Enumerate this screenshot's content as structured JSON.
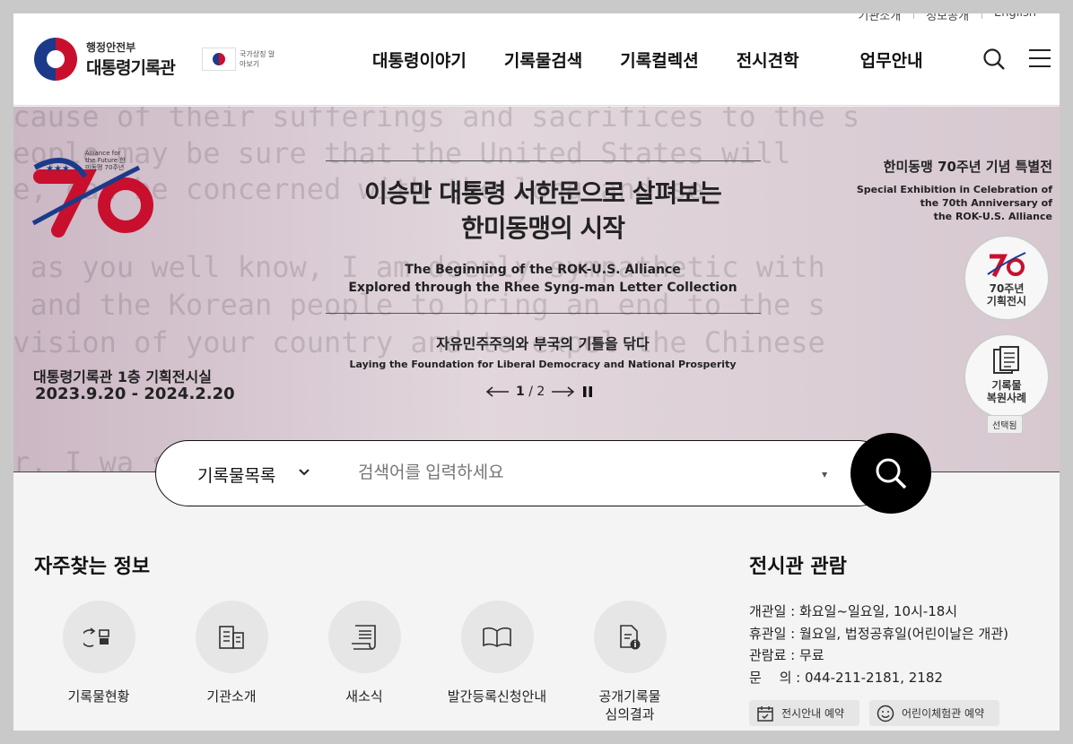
{
  "topbar": [
    "기관소개",
    "정보공개",
    "English"
  ],
  "logo": {
    "small": "행정안전부",
    "big": "대통령기록관"
  },
  "flag_text": "국가상징 알아보기",
  "gnb": [
    "대통령이야기",
    "기록물검색",
    "기록컬렉션",
    "전시견학",
    "업무안내"
  ],
  "banner": {
    "badge_small": "Alliance for the Future 한미동맹 70주년",
    "venue": "대통령기록관 1층 기획전시실",
    "dates": "2023.9.20 - 2024.2.20",
    "title_line1": "이승만 대통령 서한문으로 살펴보는",
    "title_line2": "한미동맹의 시작",
    "subtitle_en_line1": "The Beginning of the ROK-U.S. Alliance",
    "subtitle_en_line2": "Explored through the Rhee Syng-man Letter Collection",
    "sub_ko": "자유민주주의와 부국의 기틀을 닦다",
    "sub_en": "Laying the Foundation for Liberal Democracy and National Prosperity",
    "right_title_ko": "한미동맹 70주년 기념 특별전",
    "right_title_en1": "Special Exhibition in Celebration of",
    "right_title_en2": "the 70th Anniversary of",
    "right_title_en3": "the ROK-U.S. Alliance",
    "circle1_line1": "70주년",
    "circle1_line2": "기획전시",
    "circle2_line1": "기록물",
    "circle2_line2": "복원사례",
    "selected": "선택됨",
    "page_current": "1",
    "page_total": "2",
    "bg_lines": [
      "ecause of their sufferings and sacrifices to the s",
      "  people may be sure that the United States will",
      "ce, can be concerned with the long and se",
      " , as you well know, I am deeply sympathetic with",
      "f and the Korean people to bring an end to the s",
      "ivision of your country and to expel the Chinese",
      "or. I wa                                 state"
    ]
  },
  "search": {
    "scope": "기록물목록",
    "placeholder": "검색어를 입력하세요"
  },
  "faq": {
    "title": "자주찾는 정보",
    "items": [
      {
        "label": "기록물현황",
        "icon": "archive-status-icon"
      },
      {
        "label": "기관소개",
        "icon": "building-icon"
      },
      {
        "label": "새소식",
        "icon": "news-icon"
      },
      {
        "label": "발간등록신청안내",
        "icon": "book-icon"
      },
      {
        "label": "공개기록물 심의결과",
        "icon": "document-info-icon"
      }
    ]
  },
  "visit": {
    "title": "전시관 관람",
    "lines": [
      "개관일 : 화요일~일요일, 10시-18시",
      "휴관일 : 월요일, 법정공휴일(어린이날은 개관)",
      "관람료 : 무료",
      "문　 의 : 044-211-2181, 2182"
    ],
    "btn1": "전시안내 예약",
    "btn2": "어린이체험관 예약"
  }
}
